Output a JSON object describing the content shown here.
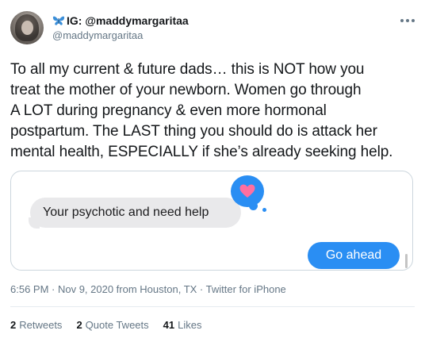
{
  "author": {
    "display_name": "IG: @maddymargaritaa",
    "handle": "@maddymargaritaa",
    "name_emoji": "butterfly-icon"
  },
  "tweet": {
    "text": "To all my current & future dads… this is NOT how you\ntreat the mother of your newborn. Women go through\nA LOT during pregnancy & even more hormonal\npostpartum. The LAST thing you should do is attack her\nmental health, ESPECIALLY if she’s already seeking help.",
    "meta": "6:56 PM · Nov 9, 2020 from Houston, TX · Twitter for iPhone"
  },
  "media": {
    "received_message": "Your psychotic and need help",
    "sent_message": "Go ahead",
    "reaction": "heart-icon"
  },
  "stats": [
    {
      "count": "2",
      "label": "Retweets"
    },
    {
      "count": "2",
      "label": "Quote Tweets"
    },
    {
      "count": "41",
      "label": "Likes"
    }
  ],
  "colors": {
    "imessage_blue": "#2a8ef3",
    "received_bubble": "#e9e9eb",
    "heart": "#ff6fa0",
    "secondary_text": "#657786"
  }
}
